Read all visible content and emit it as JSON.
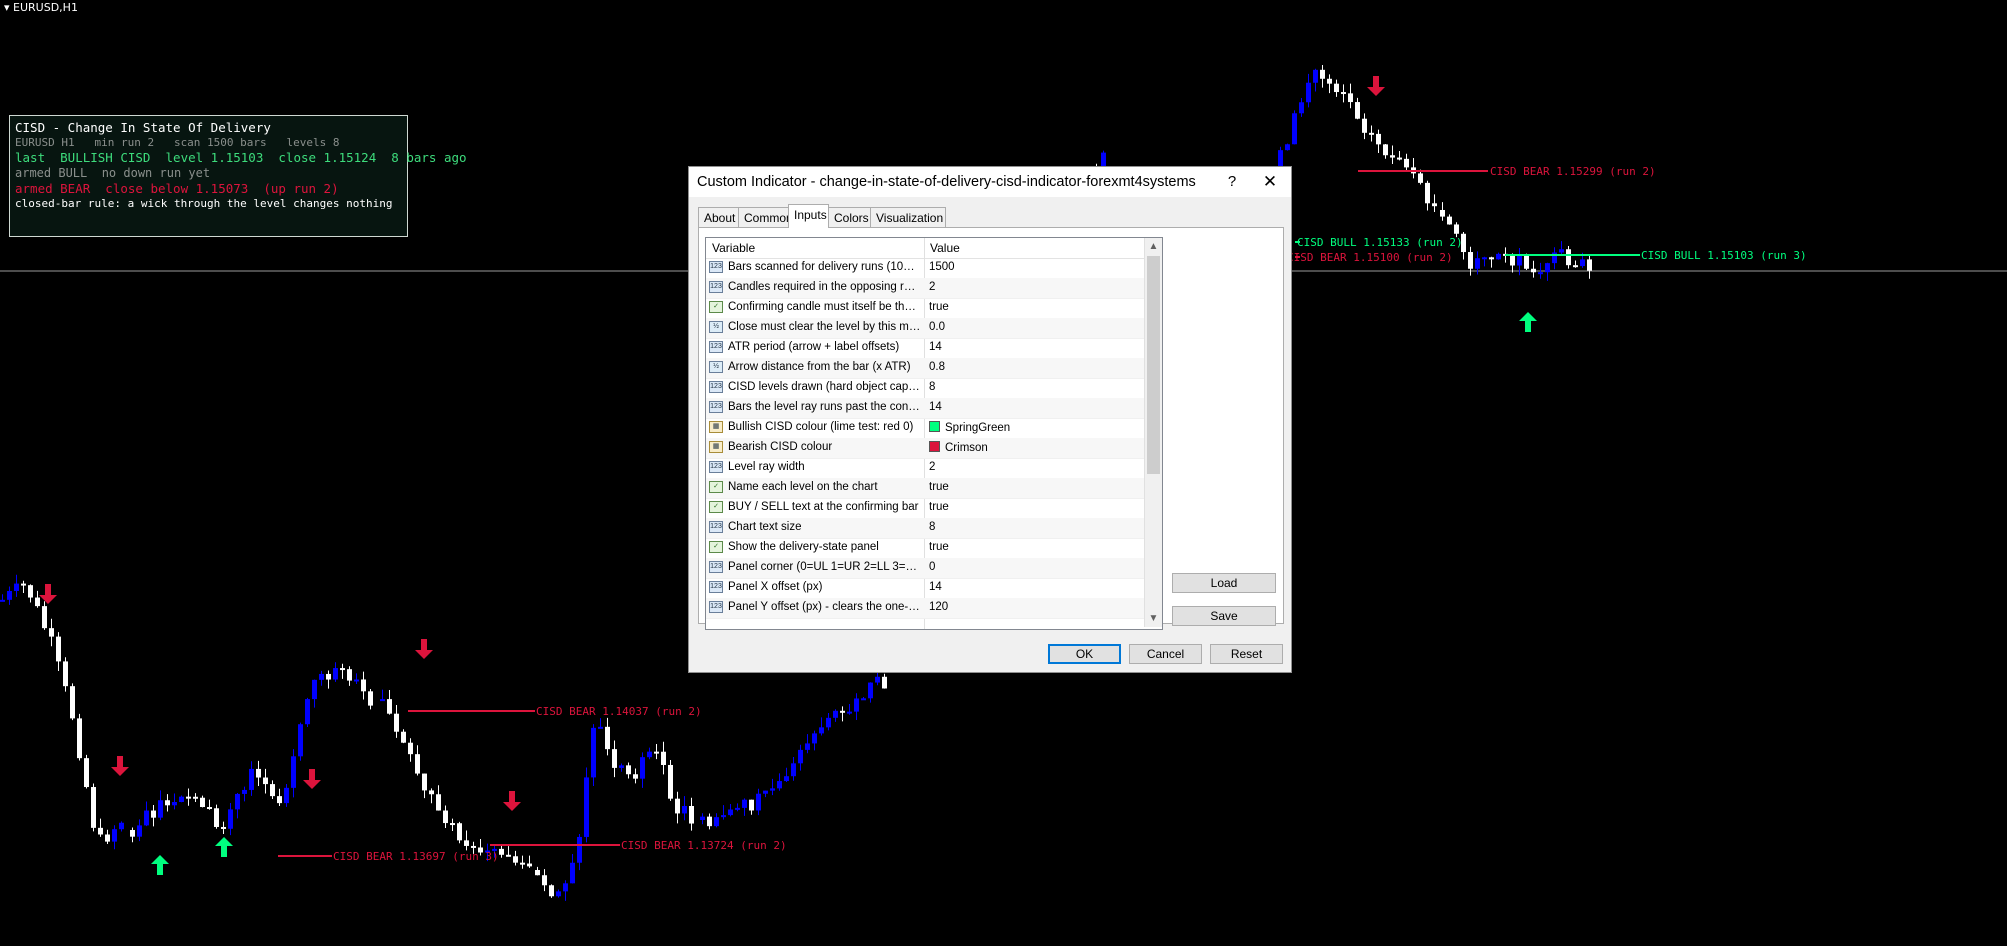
{
  "symbol": "EURUSD,H1",
  "panel": {
    "title": "CISD - Change In State Of Delivery",
    "subtitle": "EURUSD H1   min run 2   scan 1500 bars   levels 8",
    "last": "last  BULLISH CISD  level 1.15103  close 1.15124  8 bars ago",
    "armed_bull": "armed BULL  no down run yet",
    "armed_bear": "armed BEAR  close below 1.15073  (up run 2)",
    "rule": "closed-bar rule: a wick through the level changes nothing"
  },
  "levels": [
    {
      "label": "CISD BEAR 1.15299 (run 2)",
      "type": "bear"
    },
    {
      "label": "CISD BULL 1.15133 (run 2)",
      "type": "bull"
    },
    {
      "label": "CISD BEAR 1.15100 (run 2)",
      "type": "bear"
    },
    {
      "label": "CISD BULL 1.15103 (run 3)",
      "type": "bull"
    },
    {
      "label": "CISD BEAR 1.14037 (run 2)",
      "type": "bear"
    },
    {
      "label": "CISD BEAR 1.13697 (run 3)",
      "type": "bear"
    },
    {
      "label": "CISD BEAR 1.13724 (run 2)",
      "type": "bear"
    }
  ],
  "colors": {
    "bull": "#00FF7F",
    "bear": "#DC143C",
    "bull_candle": "#0000FF",
    "bear_candle": "#FFFFFF"
  },
  "dialog": {
    "title": "Custom Indicator - change-in-state-of-delivery-cisd-indicator-forexmt4systems",
    "help": "?",
    "close": "✕",
    "tabs": [
      "About",
      "Common",
      "Inputs",
      "Colors",
      "Visualization"
    ],
    "active_tab": "Inputs",
    "columns": [
      "Variable",
      "Value"
    ],
    "rows": [
      {
        "icon": "int",
        "variable": "Bars scanned for delivery runs (100..20...",
        "value": "1500"
      },
      {
        "icon": "int",
        "variable": "Candles required in the opposing run (1...",
        "value": "2"
      },
      {
        "icon": "bool",
        "variable": "Confirming candle must itself be the op...",
        "value": "true"
      },
      {
        "icon": "dbl",
        "variable": "Close must clear the level by this many ...",
        "value": "0.0"
      },
      {
        "icon": "int",
        "variable": "ATR period (arrow + label offsets)",
        "value": "14"
      },
      {
        "icon": "dbl",
        "variable": "Arrow distance from the bar (x ATR)",
        "value": "0.8"
      },
      {
        "icon": "int",
        "variable": "CISD levels drawn (hard object cap, 1....",
        "value": "8"
      },
      {
        "icon": "int",
        "variable": "Bars the level ray runs past the confirmi...",
        "value": "14"
      },
      {
        "icon": "col",
        "variable": "Bullish CISD colour (lime test: red 0)",
        "value": "SpringGreen",
        "swatch": "#00FF7F"
      },
      {
        "icon": "col",
        "variable": "Bearish CISD colour",
        "value": "Crimson",
        "swatch": "#DC143C"
      },
      {
        "icon": "int",
        "variable": "Level ray width",
        "value": "2"
      },
      {
        "icon": "bool",
        "variable": "Name each level on the chart",
        "value": "true"
      },
      {
        "icon": "bool",
        "variable": "BUY / SELL text at the confirming bar",
        "value": "true"
      },
      {
        "icon": "int",
        "variable": "Chart text size",
        "value": "8"
      },
      {
        "icon": "bool",
        "variable": "Show the delivery-state panel",
        "value": "true"
      },
      {
        "icon": "int",
        "variable": "Panel corner (0=UL 1=UR 2=LL 3=LR)",
        "value": "0"
      },
      {
        "icon": "int",
        "variable": "Panel X offset (px)",
        "value": "14"
      },
      {
        "icon": "int",
        "variable": "Panel Y offset (px) - clears the one-clic...",
        "value": "120"
      }
    ],
    "buttons": {
      "load": "Load",
      "save": "Save",
      "ok": "OK",
      "cancel": "Cancel",
      "reset": "Reset"
    }
  }
}
